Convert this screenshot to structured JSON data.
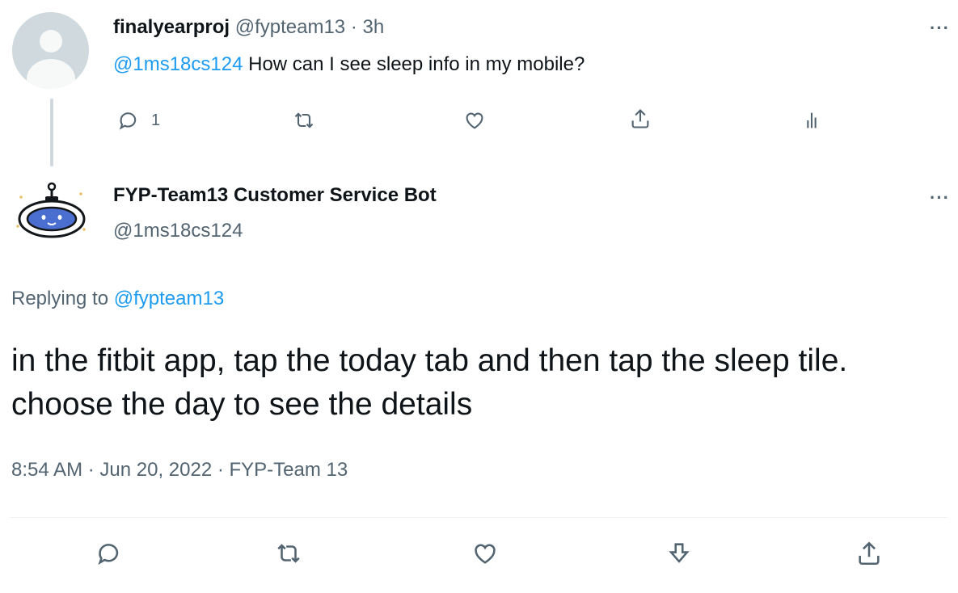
{
  "tweet": {
    "display_name": "finalyearproj",
    "handle": "@fypteam13",
    "separator": "·",
    "time_ago": "3h",
    "mention": "@1ms18cs124",
    "text": "How can I see sleep info in my mobile?",
    "reply_count": "1",
    "more_label": "···"
  },
  "reply": {
    "display_name": "FYP-Team13 Customer Service Bot",
    "handle": "@1ms18cs124",
    "replying_to_label": "Replying to",
    "replying_to_handle": "@fypteam13",
    "text": "in the fitbit app, tap the today tab and then tap the sleep tile. choose the day to see the details",
    "timestamp": "8:54 AM · Jun 20, 2022 · FYP-Team 13",
    "more_label": "···"
  },
  "colors": {
    "link": "#1d9bf0",
    "muted": "#536471",
    "text": "#0f1419",
    "avatar_bg": "#cfd9de"
  },
  "icons": {
    "reply": "speech-bubble-icon",
    "retweet": "retweet-icon",
    "like": "heart-icon",
    "share": "share-icon",
    "analytics": "analytics-bars-icon",
    "bookmark": "download-arrow-icon"
  }
}
